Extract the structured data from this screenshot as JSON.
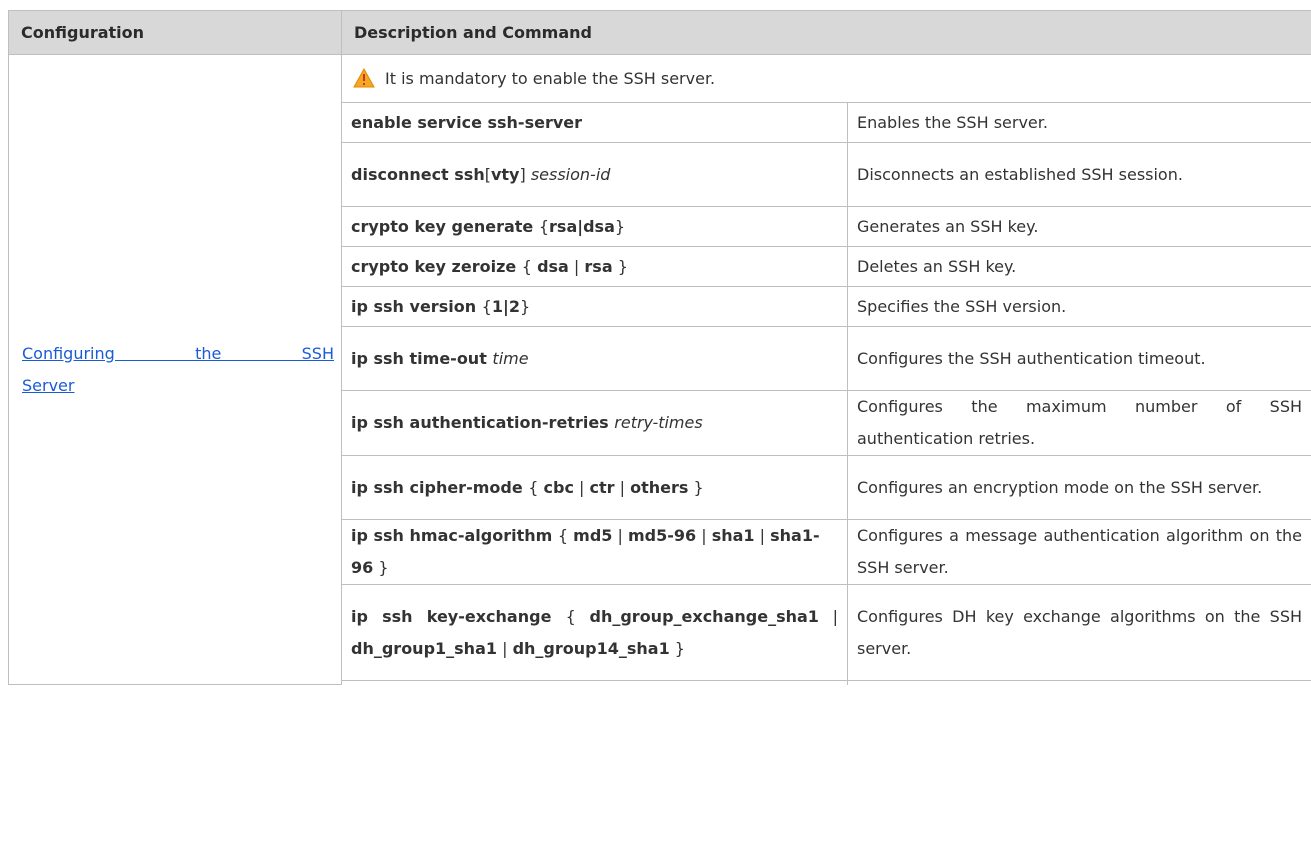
{
  "header": {
    "col1": "Configuration",
    "col2": "Description and Command"
  },
  "section": {
    "config_link_line1": "Configuring the SSH",
    "config_link_line2": "Server",
    "note": "It is mandatory to enable the SSH server.",
    "note_icon": "warning-icon"
  },
  "rows": [
    {
      "cmd": [
        [
          "b",
          "enable service ssh-server"
        ]
      ],
      "desc": "Enables the SSH server."
    },
    {
      "cmd": [
        [
          "b",
          "disconnect ssh"
        ],
        [
          "n",
          "["
        ],
        [
          "b",
          "vty"
        ],
        [
          "n",
          "] "
        ],
        [
          "i",
          "session-id"
        ]
      ],
      "desc": "Disconnects an established SSH session."
    },
    {
      "cmd": [
        [
          "b",
          "crypto key generate "
        ],
        [
          "n",
          "{"
        ],
        [
          "b",
          "rsa|dsa"
        ],
        [
          "n",
          "}"
        ]
      ],
      "desc": "Generates an SSH key."
    },
    {
      "cmd": [
        [
          "b",
          "crypto key zeroize "
        ],
        [
          "n",
          "{ "
        ],
        [
          "b",
          "dsa"
        ],
        [
          "n",
          " | "
        ],
        [
          "b",
          "rsa"
        ],
        [
          "n",
          " }"
        ]
      ],
      "desc": "Deletes an SSH key."
    },
    {
      "cmd": [
        [
          "b",
          "ip ssh version "
        ],
        [
          "n",
          "{"
        ],
        [
          "b",
          "1|2"
        ],
        [
          "n",
          "}"
        ]
      ],
      "desc": "Specifies the SSH version."
    },
    {
      "cmd": [
        [
          "b",
          "ip ssh time-out "
        ],
        [
          "i",
          "time"
        ]
      ],
      "desc": "Configures the SSH authentication timeout."
    },
    {
      "cmd": [
        [
          "b",
          "ip ssh authentication-retries "
        ],
        [
          "i",
          "retry-times"
        ]
      ],
      "desc": "Configures the maximum number of SSH authentication retries."
    },
    {
      "cmd": [
        [
          "b",
          "ip ssh cipher-mode "
        ],
        [
          "n",
          "{ "
        ],
        [
          "b",
          "cbc"
        ],
        [
          "n",
          " | "
        ],
        [
          "b",
          "ctr"
        ],
        [
          "n",
          " | "
        ],
        [
          "b",
          "others"
        ],
        [
          "n",
          " }"
        ]
      ],
      "desc": "Configures an encryption mode on the SSH server."
    },
    {
      "cmd": [
        [
          "b",
          "ip ssh hmac-algorithm "
        ],
        [
          "n",
          "{ "
        ],
        [
          "b",
          "md5"
        ],
        [
          "n",
          " | "
        ],
        [
          "b",
          "md5-96"
        ],
        [
          "n",
          " | "
        ],
        [
          "b",
          "sha1"
        ],
        [
          "n",
          " | "
        ],
        [
          "b",
          "sha1-96"
        ],
        [
          "n",
          " }"
        ]
      ],
      "desc": "Configures a message authentication algorithm on the SSH server."
    },
    {
      "cmd": [
        [
          "b",
          "ip ssh key-exchange "
        ],
        [
          "n",
          "{ "
        ],
        [
          "b",
          "dh_group_exchange_sha1"
        ],
        [
          "n",
          " | "
        ],
        [
          "b",
          "dh_group1_sha1"
        ],
        [
          "n",
          " | "
        ],
        [
          "b",
          "dh_group14_sha1"
        ],
        [
          "n",
          " }"
        ]
      ],
      "desc": "Configures DH key exchange algorithms on the SSH server."
    }
  ]
}
